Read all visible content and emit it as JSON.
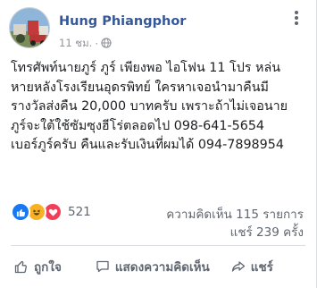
{
  "post": {
    "author": "Hung Phiangphor",
    "time": "11 ชม.",
    "privacy_icon": "globe-icon",
    "text_lines": [
      "โทรศัพท์นายภูร์ ภูร์ เพียงพอ ไอโฟน 11 โปร หล่น",
      "หายหลังโรงเรียนอุดรพิทย์ ใครหาเจอนำมาคืนมี",
      "รางวัลส่งคืน 20,000 บาทครับ เพราะถ้าไม่เจอนาย",
      "ภูร์จะใต้ใช้ซัมซุงฮีโร่ตลอดไป 098-641-5654",
      "เบอร์ภูร์ครับ คืนและรับเงินที่ผมได้ 094-7898954"
    ]
  },
  "stats": {
    "reaction_icons": [
      "like-icon",
      "haha-icon",
      "love-icon"
    ],
    "reaction_count": "521",
    "comments": "ความคิดเห็น 115 รายการ",
    "shares": "แชร์ 239 ครั้ง"
  },
  "actions": {
    "like": "ถูกใจ",
    "comment": "แสดงความคิดเห็น",
    "share": "แชร์"
  },
  "colors": {
    "author": "#365899",
    "like": "#1877f2",
    "haha": "#f7b125",
    "love": "#f33e58",
    "muted": "#606770"
  }
}
